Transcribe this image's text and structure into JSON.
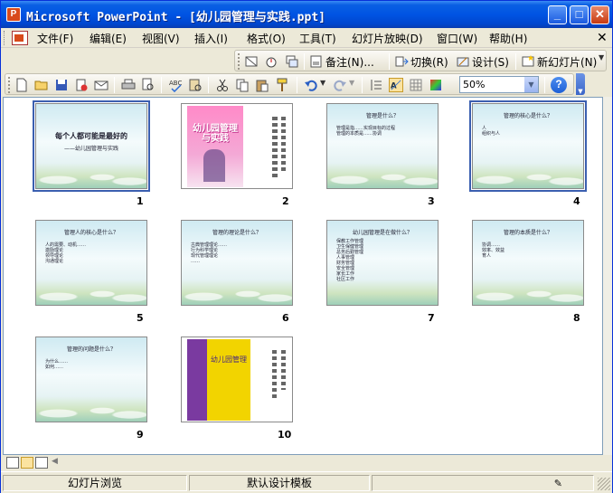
{
  "window": {
    "app_name": "Microsoft PowerPoint",
    "title": "Microsoft PowerPoint - [幼儿园管理与实践.ppt]",
    "app_icon": "powerpoint-icon",
    "controls": [
      "minimize",
      "maximize",
      "close"
    ]
  },
  "menu": {
    "items": [
      "文件(F)",
      "编辑(E)",
      "视图(V)",
      "插入(I)",
      "格式(O)",
      "工具(T)",
      "幻灯片放映(D)",
      "窗口(W)",
      "帮助(H)"
    ],
    "close_glyph": "✕"
  },
  "slide_sorter_toolbar": {
    "notes_label": "备注(N)...",
    "transition_label": "切换(R)",
    "design_label": "设计(S)",
    "new_slide_label": "新幻灯片(N)"
  },
  "standard_toolbar": {
    "zoom": "50%",
    "help_glyph": "?"
  },
  "slides": [
    {
      "number": "1",
      "kind": "title",
      "selected": true,
      "title": "每个人都可能是最好的",
      "subtitle": "——幼儿园管理与实践"
    },
    {
      "number": "2",
      "kind": "cover",
      "selected": false,
      "title": "幼儿园管理与实践"
    },
    {
      "number": "3",
      "kind": "bullets",
      "selected": false,
      "title": "管理是什么？",
      "bullets": [
        "管理是指……实现目标的过程",
        "管理的本质是……协调"
      ]
    },
    {
      "number": "4",
      "kind": "bullets",
      "selected": true,
      "title": "管理的核心是什么？",
      "bullets": [
        "人",
        "组织与人"
      ]
    },
    {
      "number": "5",
      "kind": "bullets",
      "selected": false,
      "title": "管理人的核心是什么？",
      "bullets": [
        "人的需要、动机……",
        "激励理论",
        "领导理论",
        "沟通理论"
      ]
    },
    {
      "number": "6",
      "kind": "bullets",
      "selected": false,
      "title": "管理的理论是什么？",
      "bullets": [
        "古典管理理论……",
        "行为科学理论",
        "现代管理理论",
        "……"
      ]
    },
    {
      "number": "7",
      "kind": "bullets",
      "selected": false,
      "title": "幼儿园管理是在做什么？",
      "bullets": [
        "保教工作管理",
        "卫生保健管理",
        "总务后勤管理",
        "人事管理",
        "财务管理",
        "安全管理",
        "家长工作",
        "社区工作"
      ]
    },
    {
      "number": "8",
      "kind": "bullets",
      "selected": false,
      "title": "管理的本质是什么？",
      "bullets": [
        "协调……",
        "效率、效益",
        "育人"
      ]
    },
    {
      "number": "9",
      "kind": "bullets",
      "selected": false,
      "title": "管理的问题是什么？",
      "bullets": [
        "为什么……",
        "如何……"
      ]
    },
    {
      "number": "10",
      "kind": "book",
      "selected": false,
      "title": "幼儿园管理"
    }
  ],
  "status_bar": {
    "view": "幻灯片浏览",
    "template": "默认设计模板"
  },
  "colors": {
    "titlebar": "#0054e3",
    "chrome": "#ece9d8",
    "selection": "#3b5fb0"
  }
}
